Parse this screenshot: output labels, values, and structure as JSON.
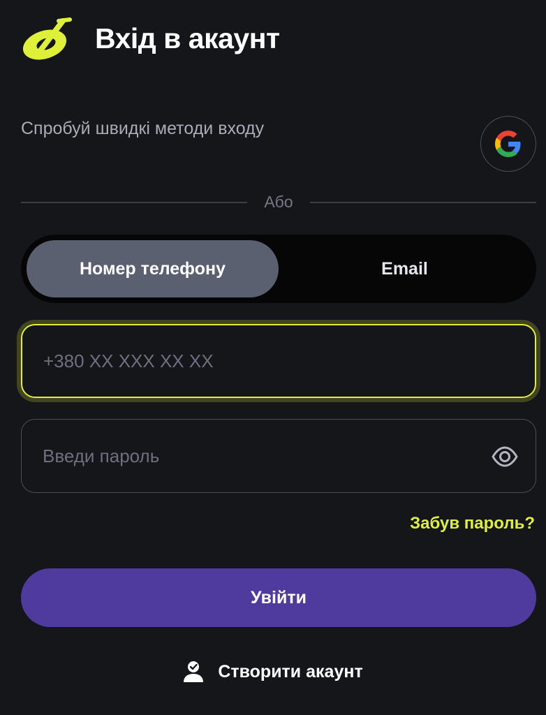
{
  "header": {
    "title": "Вхід в акаунт",
    "logo_icon": "brand-logo-icon"
  },
  "quick_login": {
    "text": "Спробуй швидкі методи входу",
    "google_icon": "google-icon"
  },
  "divider": {
    "text": "Або"
  },
  "login_method_tabs": [
    {
      "label": "Номер телефону",
      "active": true
    },
    {
      "label": "Email",
      "active": false
    }
  ],
  "phone_field": {
    "value": "",
    "placeholder": "+380 XX XXX XX XX"
  },
  "password_field": {
    "value": "",
    "placeholder": "Введи пароль",
    "toggle_icon": "eye-icon"
  },
  "forgot_password": "Забув пароль?",
  "submit_label": "Увійти",
  "create_account": {
    "label": "Створити акаунт",
    "icon": "user-check-icon"
  },
  "colors": {
    "background": "#15161a",
    "accent": "#dff03a",
    "primary_button": "#4f3a9e",
    "active_tab": "#5b6071",
    "muted_text": "#a9acb8"
  }
}
